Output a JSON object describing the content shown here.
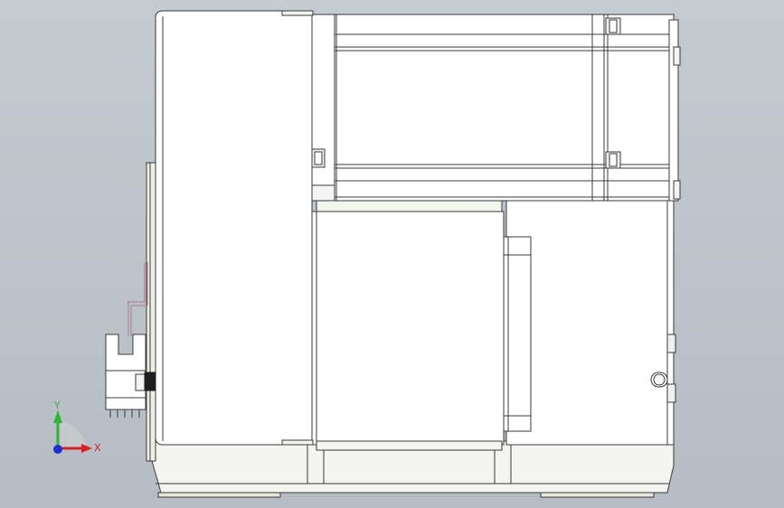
{
  "viewport": {
    "background_top": "#c4cad0",
    "background_bottom": "#b5bcc3",
    "model_face_color": "#ffffff",
    "model_edge_color": "#3a3a3a",
    "hole_color": "#1e1e1e"
  },
  "model": {
    "name_icon": "linear-module-with-servo-motor-side-view",
    "feature_colors": {
      "bracket_accent": "#b0788c",
      "side_panel": "#eef0e6"
    }
  },
  "triad": {
    "y_label": "Y",
    "x_label": "X",
    "y_color": "#2fb52f",
    "x_color": "#d92020",
    "z_color": "#1f2fd6"
  }
}
